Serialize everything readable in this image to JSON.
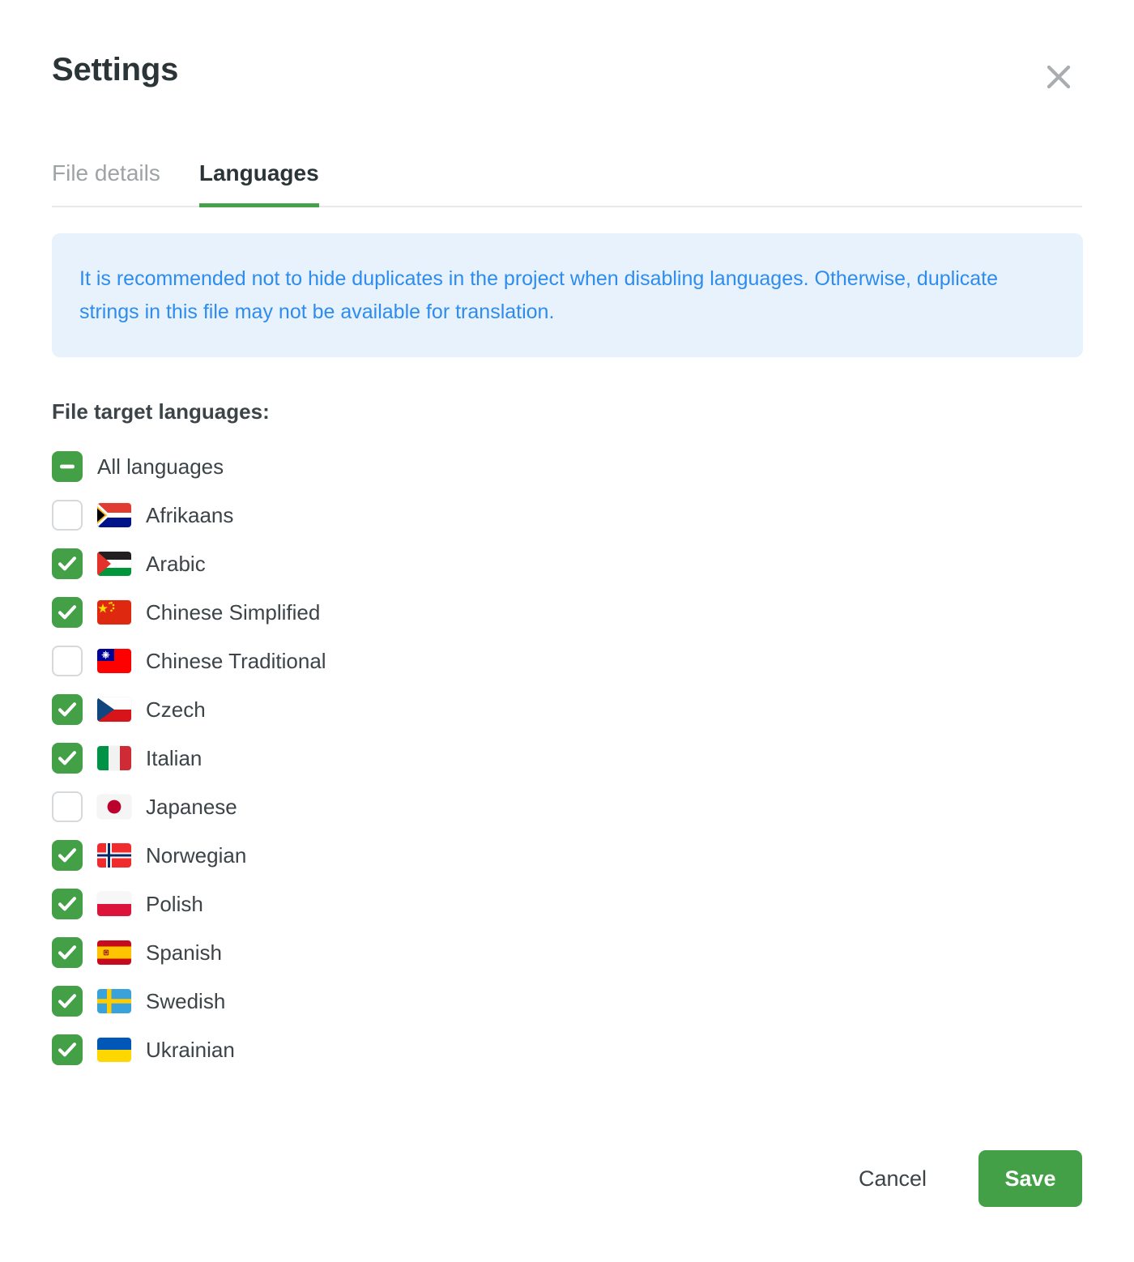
{
  "dialog": {
    "title": "Settings",
    "close_icon": "close-icon"
  },
  "tabs": [
    {
      "label": "File details",
      "active": false
    },
    {
      "label": "Languages",
      "active": true
    }
  ],
  "banner": {
    "text": "It is recommended not to hide duplicates in the project when disabling languages. Otherwise, duplicate strings in this file may not be available for translation."
  },
  "languages_section": {
    "label": "File target languages:",
    "all_languages": {
      "label": "All languages",
      "state": "indeterminate"
    },
    "items": [
      {
        "label": "Afrikaans",
        "checked": false,
        "flag": "za"
      },
      {
        "label": "Arabic",
        "checked": true,
        "flag": "ps"
      },
      {
        "label": "Chinese Simplified",
        "checked": true,
        "flag": "cn"
      },
      {
        "label": "Chinese Traditional",
        "checked": false,
        "flag": "tw"
      },
      {
        "label": "Czech",
        "checked": true,
        "flag": "cz"
      },
      {
        "label": "Italian",
        "checked": true,
        "flag": "it"
      },
      {
        "label": "Japanese",
        "checked": false,
        "flag": "jp"
      },
      {
        "label": "Norwegian",
        "checked": true,
        "flag": "no"
      },
      {
        "label": "Polish",
        "checked": true,
        "flag": "pl"
      },
      {
        "label": "Spanish",
        "checked": true,
        "flag": "es"
      },
      {
        "label": "Swedish",
        "checked": true,
        "flag": "se"
      },
      {
        "label": "Ukrainian",
        "checked": true,
        "flag": "ua"
      }
    ]
  },
  "footer": {
    "cancel_label": "Cancel",
    "save_label": "Save"
  },
  "colors": {
    "accent_green": "#43a047",
    "banner_bg": "#e8f2fd",
    "banner_text": "#2d8ced",
    "text_primary": "#3c4448",
    "text_muted": "#9ea4a6"
  }
}
